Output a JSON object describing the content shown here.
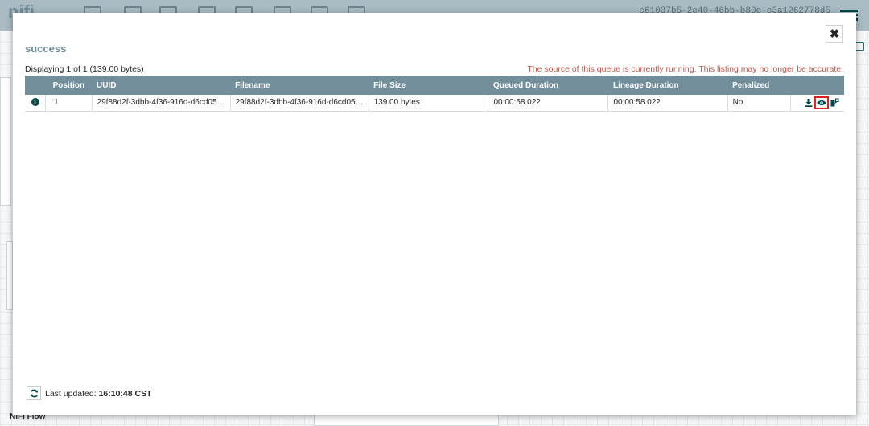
{
  "background": {
    "logo_text": "nifi",
    "uuid_text": "c61037b5-2e40-46bb-b80c-c3a1262778d5",
    "flow_label": "NiFi Flow"
  },
  "dialog": {
    "title": "success",
    "close_icon": "close-icon",
    "summary": "Displaying 1 of 1 (139.00 bytes)",
    "warning": "The source of this queue is currently running. This listing may no longer be accurate.",
    "columns": [
      "Position",
      "UUID",
      "Filename",
      "File Size",
      "Queued Duration",
      "Lineage Duration",
      "Penalized"
    ],
    "rows": [
      {
        "position": "1",
        "uuid": "29f88d2f-3dbb-4f36-916d-d6cd05…",
        "filename": "29f88d2f-3dbb-4f36-916d-d6cd05…",
        "file_size": "139.00 bytes",
        "queued_duration": "00:00:58.022",
        "lineage_duration": "00:00:58.022",
        "penalized": "No",
        "actions": [
          "download-icon",
          "view-icon",
          "provenance-icon"
        ]
      }
    ],
    "footer": {
      "last_updated_label": "Last updated:",
      "last_updated_value": "16:10:48 CST"
    }
  },
  "colors": {
    "header": "#728e9b",
    "warning": "#ba554a",
    "accent": "#004849",
    "highlight": "#e02020"
  }
}
